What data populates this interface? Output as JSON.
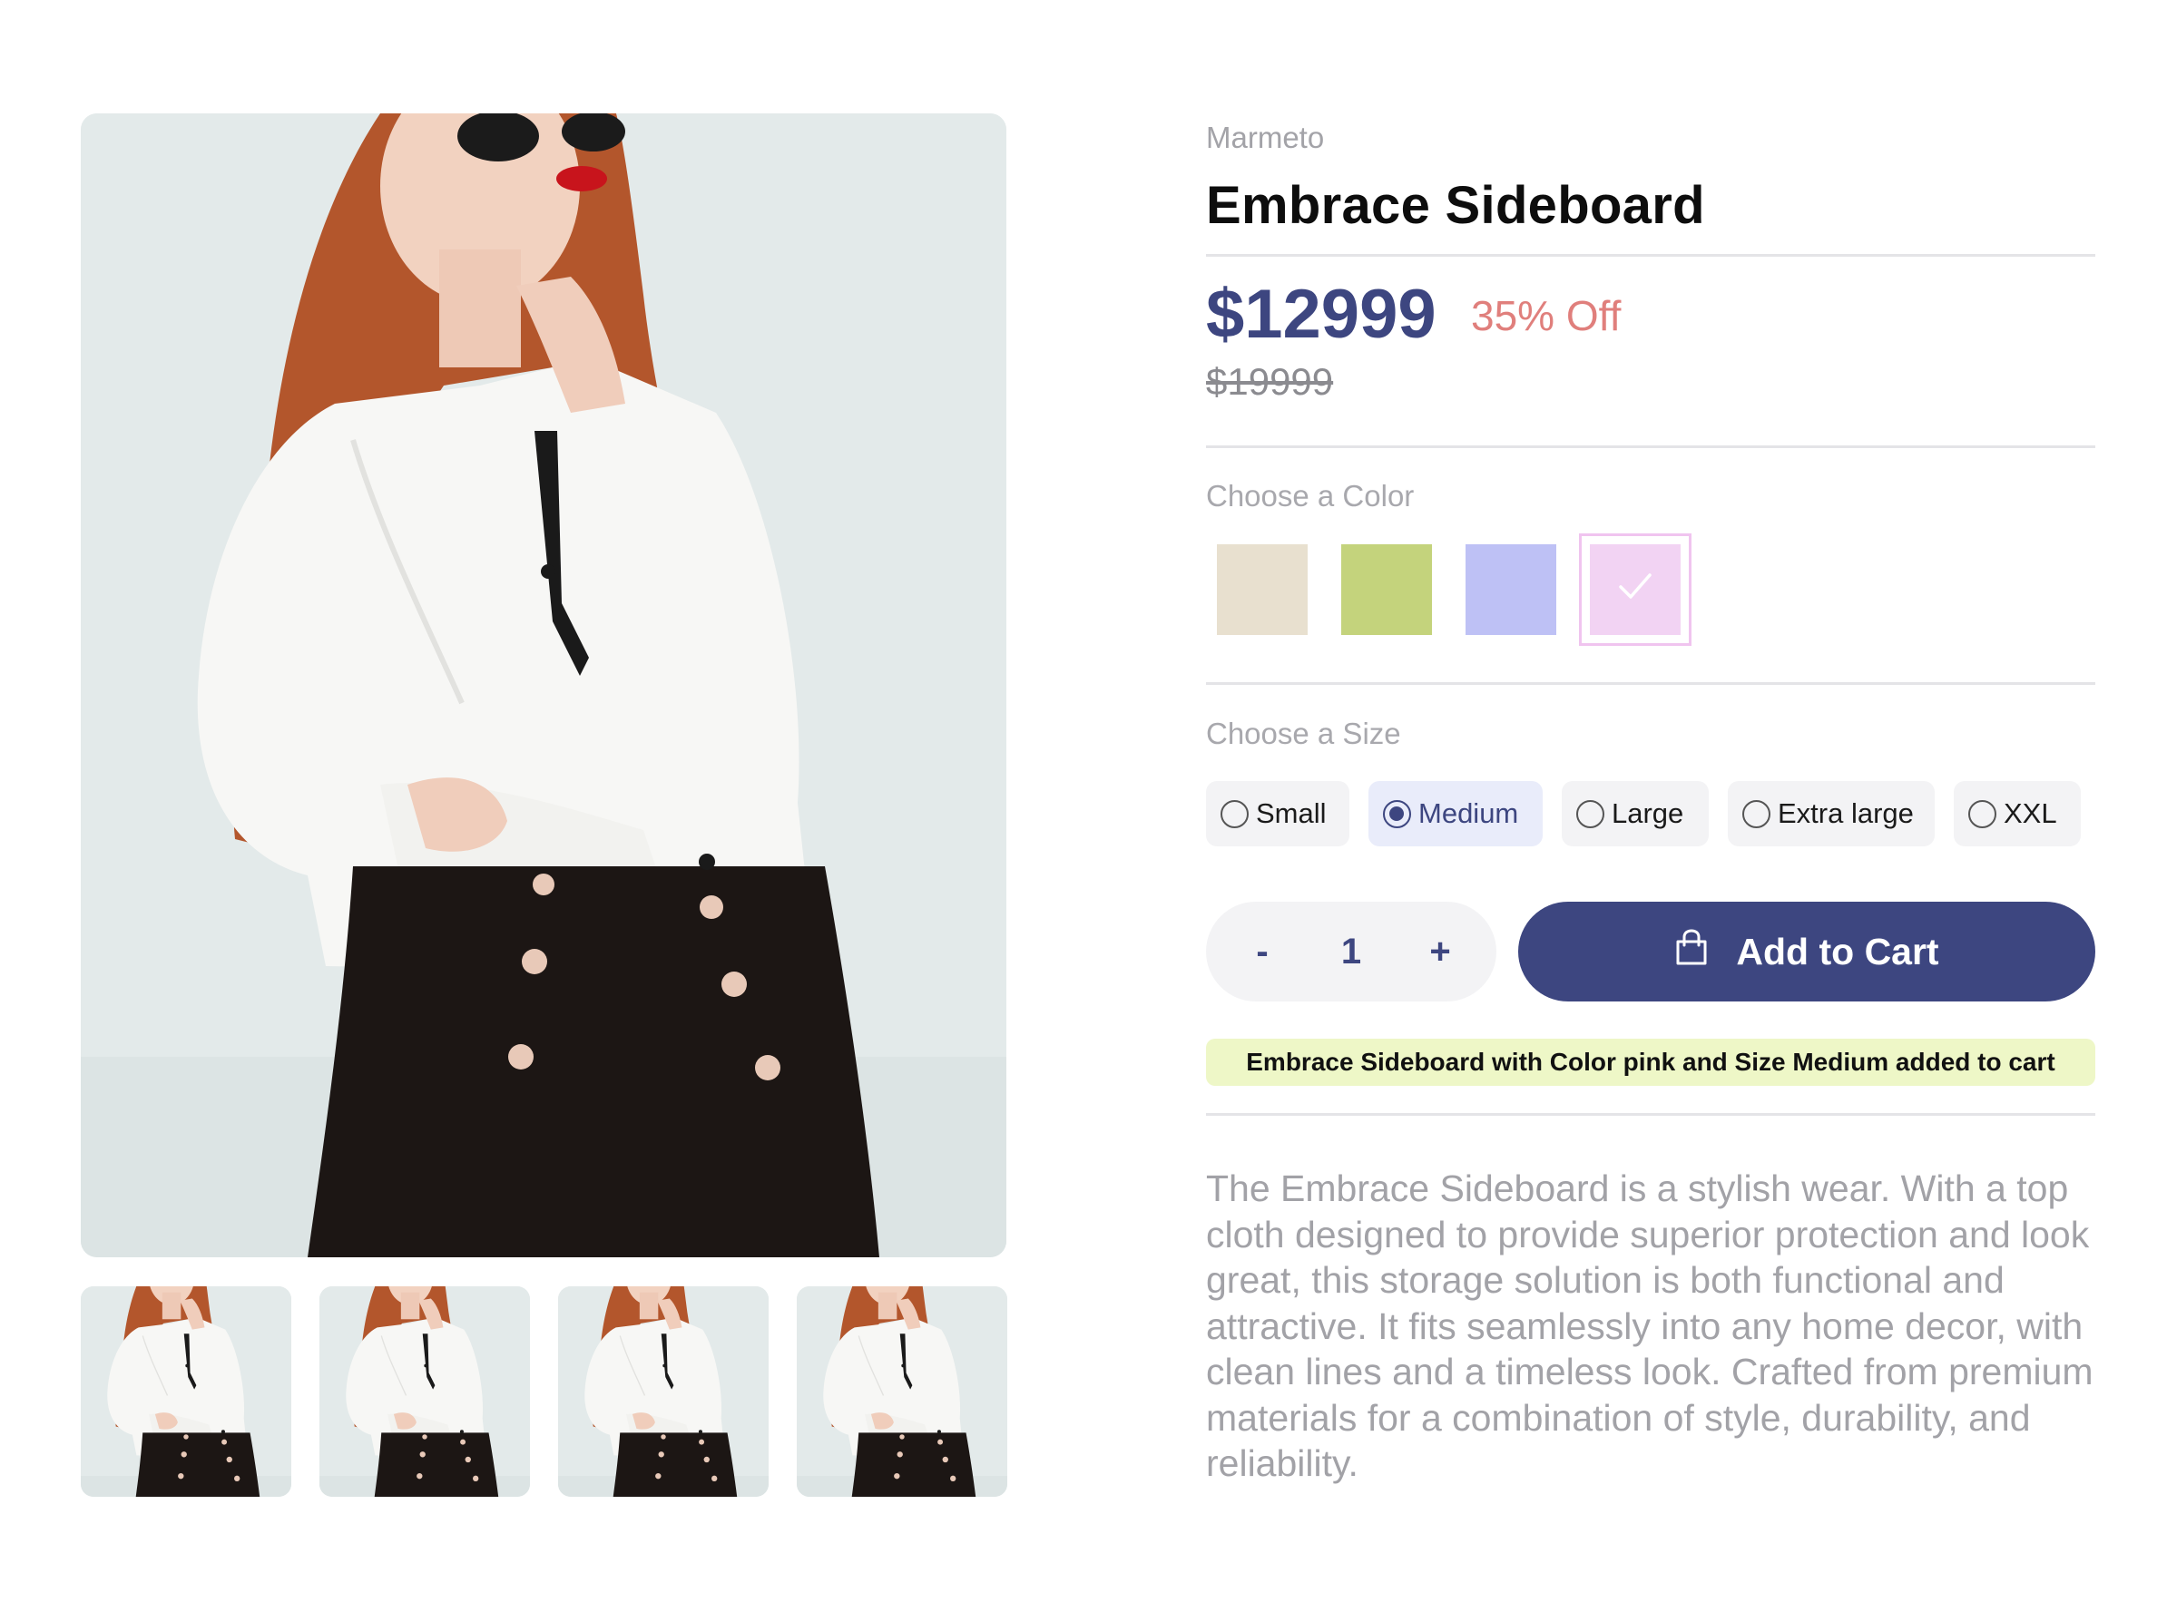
{
  "gallery": {
    "thumbnails": [
      {
        "label": "thumbnail 1"
      },
      {
        "label": "thumbnail 2"
      },
      {
        "label": "thumbnail 3"
      },
      {
        "label": "thumbnail 4"
      }
    ]
  },
  "product": {
    "brand": "Marmeto",
    "title": "Embrace Sideboard",
    "price": "$12999",
    "discount": "35% Off",
    "compare_price": "$19999",
    "description": "The Embrace Sideboard is a stylish wear. With a top cloth designed to provide superior protection and look great, this storage solution is both functional and attractive. It fits seamlessly into any home decor, with clean lines and a timeless look. Crafted from premium materials for a combination of style, durability, and reliability."
  },
  "color": {
    "label": "Choose a Color",
    "swatches": [
      {
        "name": "beige",
        "hex": "#e8e0cf",
        "selected": false
      },
      {
        "name": "green",
        "hex": "#c4d37c",
        "selected": false
      },
      {
        "name": "blue",
        "hex": "#bec1f5",
        "selected": false
      },
      {
        "name": "pink",
        "hex": "#f2d3f3",
        "selected": true
      }
    ],
    "check_icon": "check-icon"
  },
  "size": {
    "label": "Choose a Size",
    "options": [
      {
        "label": "Small",
        "selected": false
      },
      {
        "label": "Medium",
        "selected": true
      },
      {
        "label": "Large",
        "selected": false
      },
      {
        "label": "Extra large",
        "selected": false
      },
      {
        "label": "XXL",
        "selected": false
      }
    ]
  },
  "quantity": {
    "minus_label": "-",
    "value": "1",
    "plus_label": "+"
  },
  "cart": {
    "button_label": "Add to Cart",
    "icon": "shopping-bag-icon",
    "confirmation": "Embrace Sideboard with Color pink and Size Medium added to cart"
  },
  "colors": {
    "accent": "#3d4680",
    "discount": "#e07f7c",
    "toast_bg": "#eef7c7",
    "muted_text": "#a2a2a7"
  }
}
